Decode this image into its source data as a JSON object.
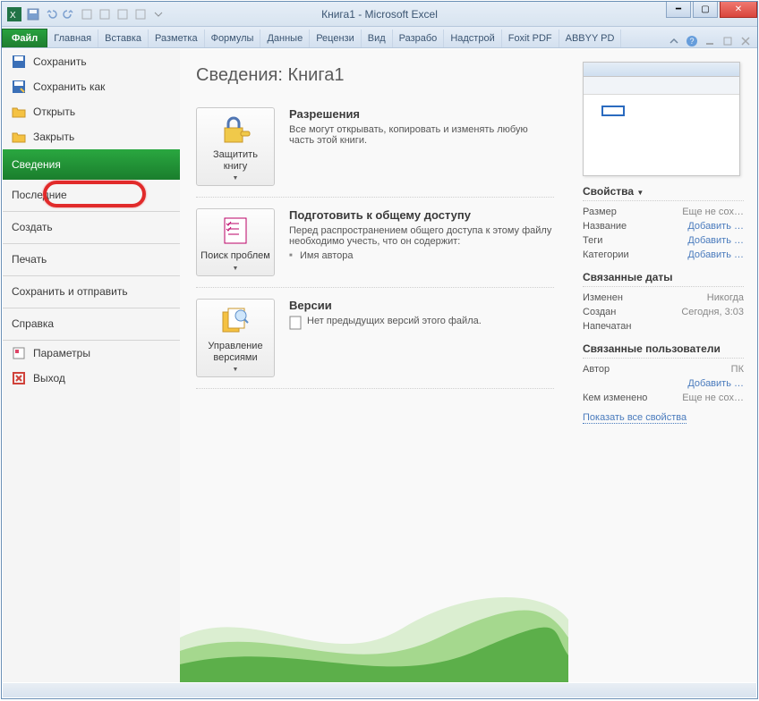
{
  "titlebar": {
    "title": "Книга1 - Microsoft Excel"
  },
  "tabs": {
    "file": "Файл",
    "items": [
      "Главная",
      "Вставка",
      "Разметка",
      "Формулы",
      "Данные",
      "Рецензи",
      "Вид",
      "Разрабо",
      "Надстрой",
      "Foxit PDF",
      "ABBYY PD"
    ]
  },
  "sidebar": {
    "save": "Сохранить",
    "save_as": "Сохранить как",
    "open": "Открыть",
    "close": "Закрыть",
    "info": "Сведения",
    "recent": "Последние",
    "new": "Создать",
    "print": "Печать",
    "save_send": "Сохранить и отправить",
    "help": "Справка",
    "options": "Параметры",
    "exit": "Выход"
  },
  "main": {
    "title": "Сведения: Книга1",
    "permissions": {
      "btn": "Защитить книгу",
      "heading": "Разрешения",
      "text": "Все могут открывать, копировать и изменять любую часть этой книги."
    },
    "prepare": {
      "btn": "Поиск проблем",
      "heading": "Подготовить к общему доступу",
      "text": "Перед распространением общего доступа к этому файлу необходимо учесть, что он содержит:",
      "bullet1": "Имя автора"
    },
    "versions": {
      "btn": "Управление версиями",
      "heading": "Версии",
      "text": "Нет предыдущих версий этого файла."
    }
  },
  "props": {
    "heading": "Свойства",
    "size_k": "Размер",
    "size_v": "Еще не сох…",
    "title_k": "Название",
    "title_v": "Добавить …",
    "tags_k": "Теги",
    "tags_v": "Добавить …",
    "cat_k": "Категории",
    "cat_v": "Добавить …",
    "dates_heading": "Связанные даты",
    "modified_k": "Изменен",
    "modified_v": "Никогда",
    "created_k": "Создан",
    "created_v": "Сегодня, 3:03",
    "printed_k": "Напечатан",
    "printed_v": "",
    "users_heading": "Связанные пользователи",
    "author_k": "Автор",
    "author_v": "ПК",
    "author_add": "Добавить …",
    "lastmod_k": "Кем изменено",
    "lastmod_v": "Еще не сох…",
    "show_all": "Показать все свойства"
  }
}
